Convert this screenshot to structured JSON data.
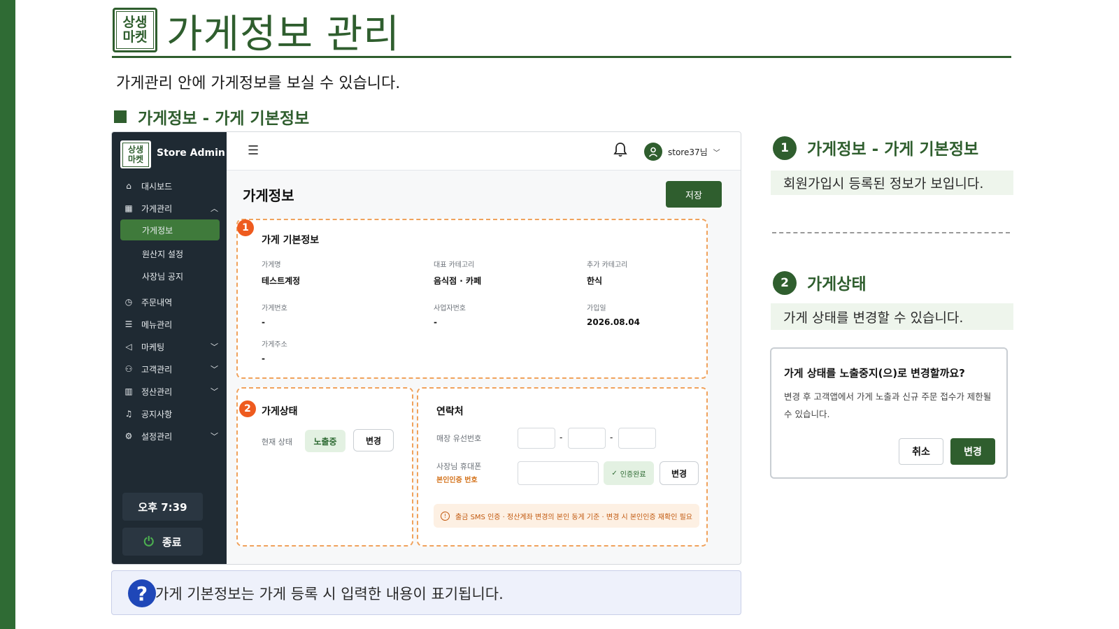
{
  "slide": {
    "logo_text_line1": "상생",
    "logo_text_line2": "마켓",
    "title": "가게정보 관리",
    "description": "가게관리 안에 가게정보를 보실 수 있습니다.",
    "section_title": "가게정보 - 가게 기본정보",
    "tip": "가게 기본정보는 가게 등록 시 입력한 내용이 표기됩니다.",
    "tip_icon": "question-icon"
  },
  "app": {
    "brand": "Store Admin",
    "sidebar": {
      "items": [
        {
          "label": "대시보드",
          "icon": "home-icon"
        },
        {
          "label": "가게관리",
          "icon": "store-icon",
          "expanded": true
        },
        {
          "label": "주문내역",
          "icon": "clock-icon"
        },
        {
          "label": "메뉴관리",
          "icon": "list-icon"
        },
        {
          "label": "마케팅",
          "icon": "megaphone-icon"
        },
        {
          "label": "고객관리",
          "icon": "users-icon"
        },
        {
          "label": "정산관리",
          "icon": "chart-icon"
        },
        {
          "label": "공지사항",
          "icon": "bell-icon"
        },
        {
          "label": "설정관리",
          "icon": "gear-icon"
        }
      ],
      "subitems": [
        "가게정보",
        "원산지 설정",
        "사장님 공지"
      ],
      "active_subitem": "가게정보",
      "time": "오후 7:39",
      "exit_label": "종료"
    },
    "topbar": {
      "user": "store37님"
    },
    "page_title": "가게정보",
    "save_label": "저장",
    "basic_info": {
      "badge": "1",
      "title": "가게 기본정보",
      "fields": {
        "store_name_label": "가게명",
        "store_name": "테스트계정",
        "main_category_label": "대표 카테고리",
        "main_category": "음식점 · 카페",
        "extra_category_label": "추가 카테고리",
        "extra_category": "한식",
        "store_number_label": "가게번호",
        "store_number": "-",
        "biz_number_label": "사업자번호",
        "biz_number": "-",
        "join_date_label": "가입일",
        "join_date": "2026.08.04",
        "address_label": "가게주소",
        "address": "-"
      }
    },
    "status": {
      "badge": "2",
      "title": "가게상태",
      "current_label": "현재 상태",
      "current_value": "노출중",
      "change_label": "변경"
    },
    "contact": {
      "title": "연락처",
      "landline_label": "매장 유선번호",
      "dash": "-",
      "mobile_label": "사장님 휴대폰",
      "mobile_sub": "본인인증 번호",
      "verified_label": "인증완료",
      "change_label": "변경",
      "notice": "출금 SMS 인증 · 정산계좌 변경의 본인 동게 기준 · 변경 시 본인인증 재확인 필요"
    }
  },
  "right": {
    "step1_num": "1",
    "step1_title": "가게정보 - 가게 기본정보",
    "step1_desc": "회원가입시 등록된 정보가 보입니다.",
    "step2_num": "2",
    "step2_title": "가게상태",
    "step2_desc": "가게 상태를 변경할 수 있습니다.",
    "dialog": {
      "question": "가게 상태를 노출중지(으)로 변경할까요?",
      "body": "변경 후 고객앱에서 가게 노출과 신규 주문 접수가 제한될 수 있습니다.",
      "cancel": "취소",
      "confirm": "변경"
    }
  },
  "colors": {
    "brand_green": "#2f5e2e",
    "sidebar_bg": "#1f2a33",
    "badge_orange": "#ee5b1f",
    "tip_blue": "#1f47b8"
  }
}
